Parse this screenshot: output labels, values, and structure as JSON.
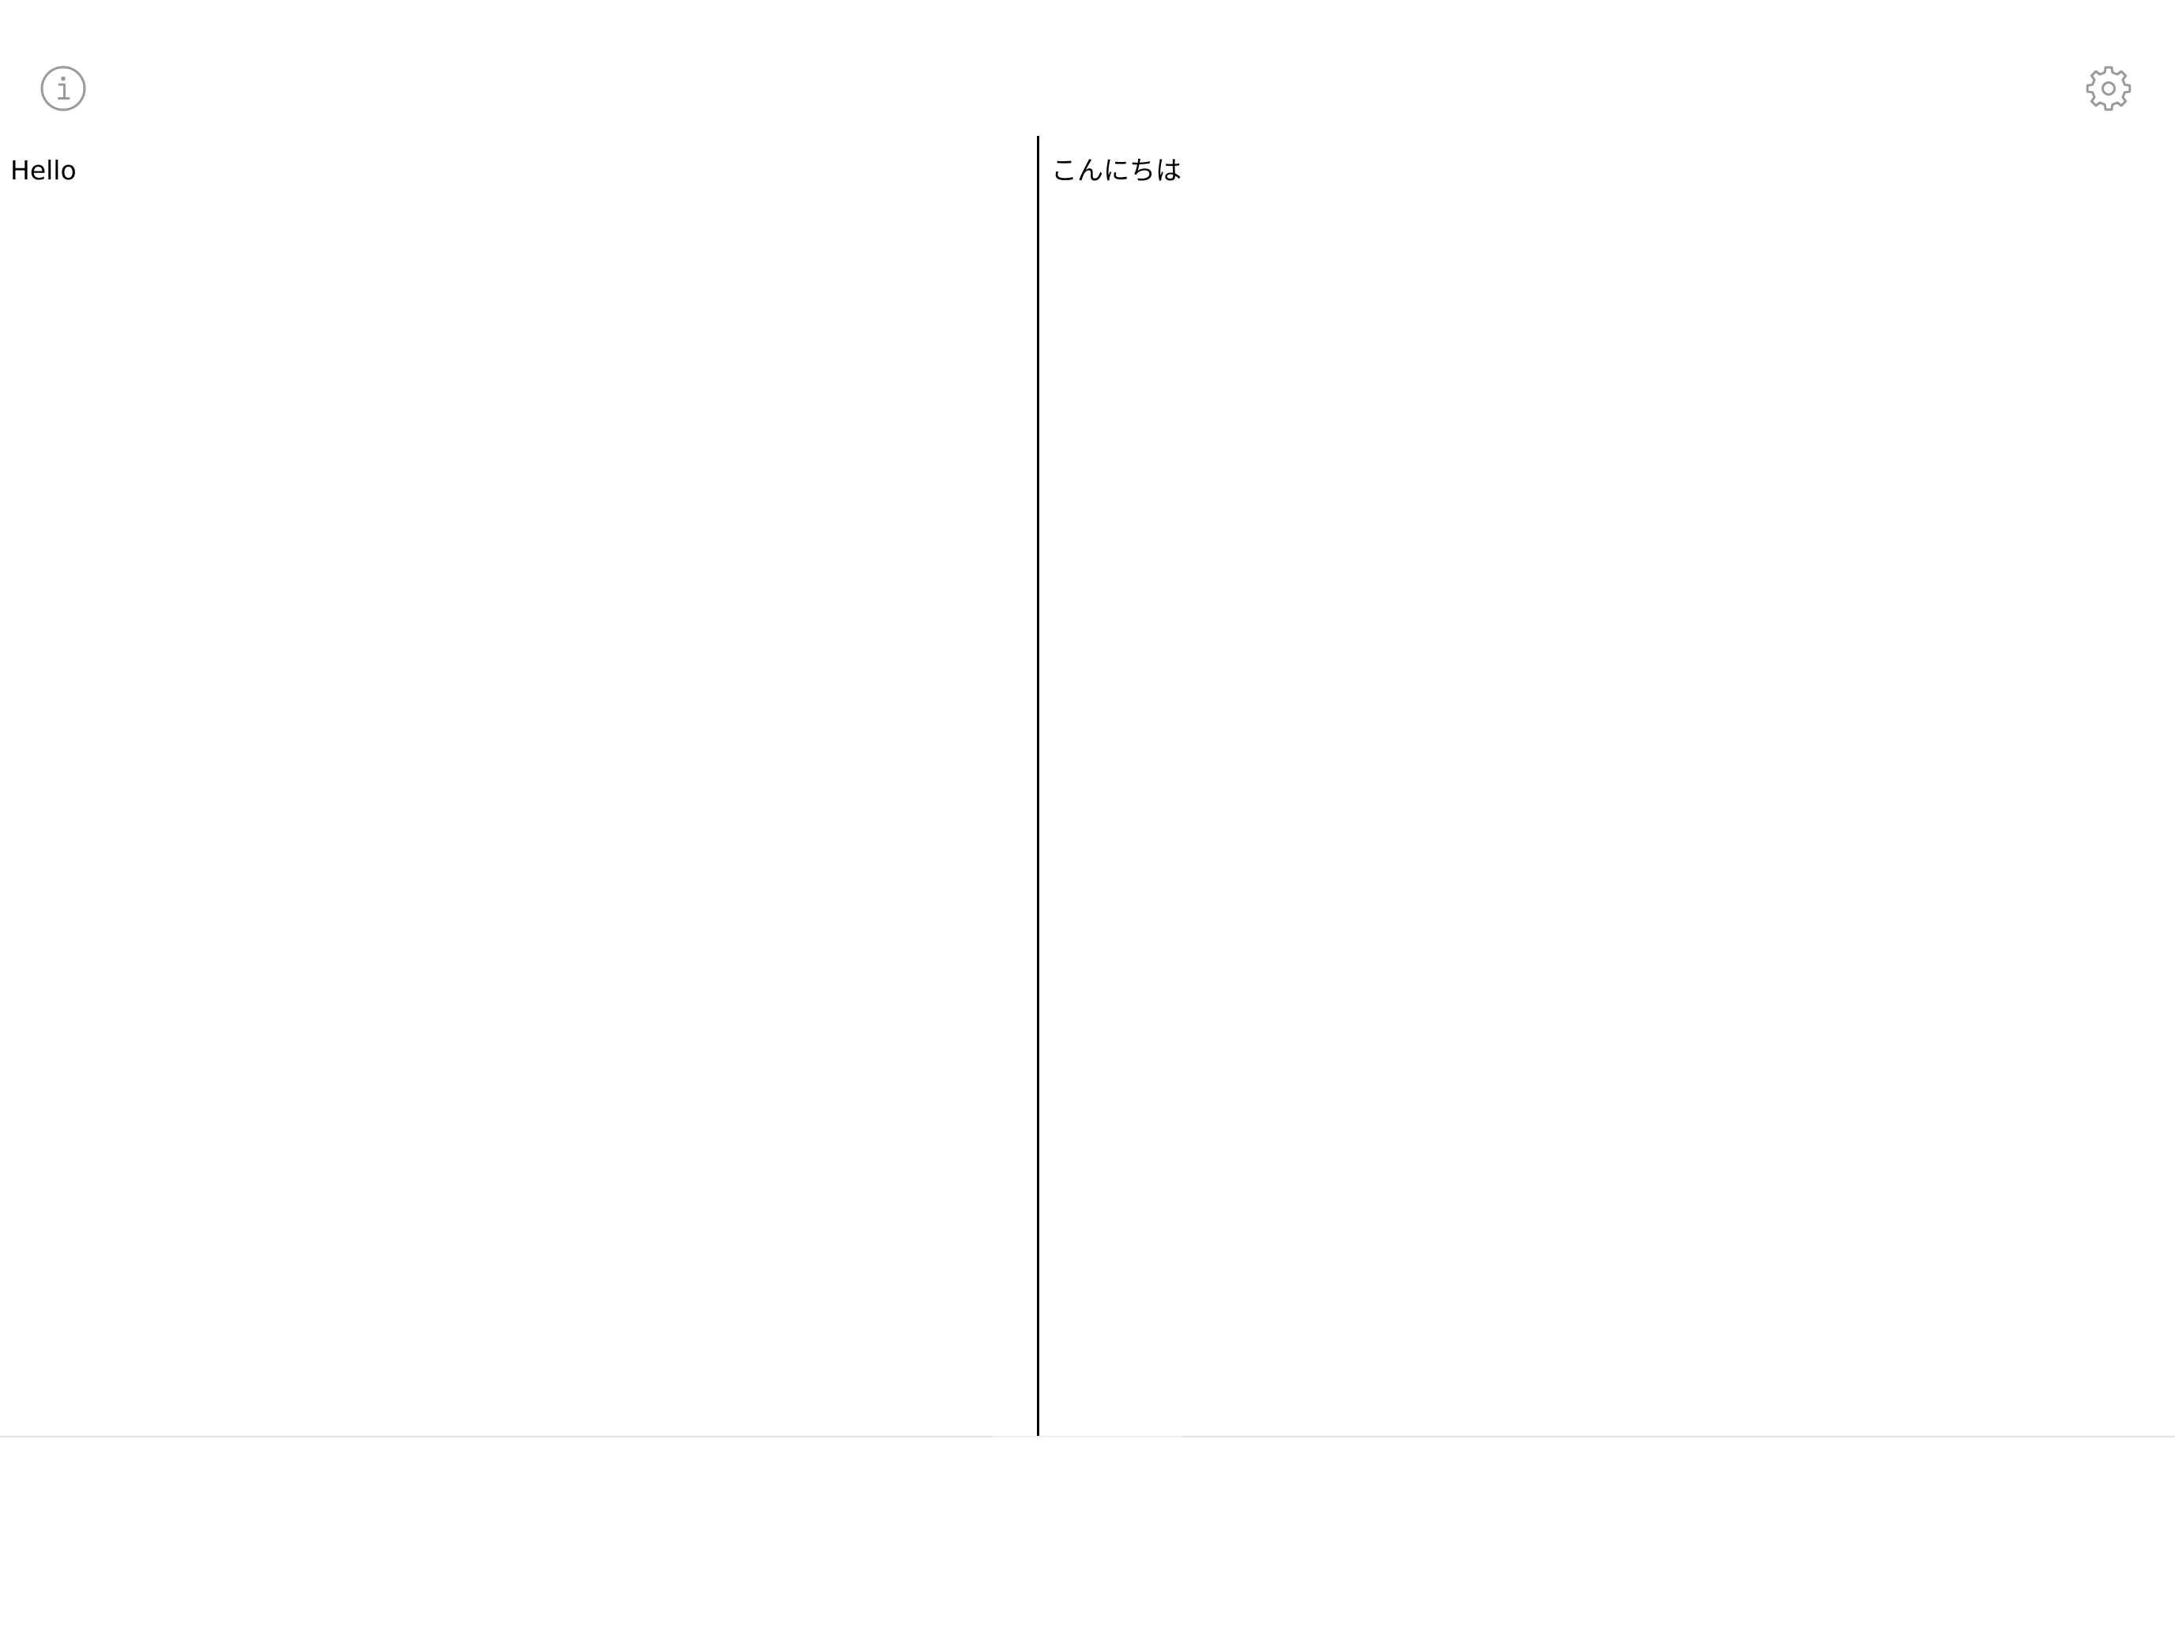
{
  "toolbar": {
    "info_icon": "info-circle-icon",
    "settings_icon": "gear-icon",
    "icon_color": "#9a9a9a"
  },
  "panes": {
    "source": {
      "text": "Hello"
    },
    "target": {
      "text": "こんにちは"
    }
  },
  "colors": {
    "background": "#ffffff",
    "text": "#000000",
    "divider": "#000000",
    "bottom_border": "#e4e4e6"
  }
}
